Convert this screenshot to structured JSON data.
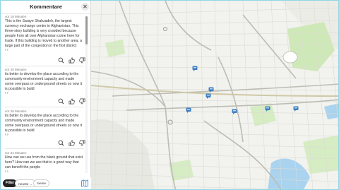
{
  "panel": {
    "title": "Kommentare",
    "close_symbol": "✕"
  },
  "comments": [
    {
      "time": "vor 18 Minuten",
      "text": "This is the Saraye Shahzadeh, the largest currency exchange centre in Afghanistan. This three-story building is very crowded because people from all over Afghanistan come here for trade. If this building is moved to another area, a large part of the congestion in the first district",
      "more": "‹  ›"
    },
    {
      "time": "vor 20 Minuten",
      "text": "its better to develop the place according to the community environment capacity and made some overpass or underground streets so now it is possible to build",
      "more": "‹  ›"
    },
    {
      "time": "vor 26 Minuten",
      "text": "its better to develop the place according to the community environment capacity and made some overpass or underground streets so now it is possible to build",
      "more": "‹  ›"
    },
    {
      "time": "vor 34 Minuten",
      "text": "How can we use from the blank ground that exist here? How can we use that in a good way that can benefit the people",
      "more": "‹  ›"
    }
  ],
  "toolbar": {
    "filter_label": "Filter",
    "sort_newest": "neuste",
    "sort_mine": "meine",
    "chevron": "⌄"
  },
  "icons": {
    "search": "search-icon",
    "like": "thumbs-up-icon",
    "dislike": "thumbs-down-icon",
    "map": "map-icon",
    "marker": "comment-marker-icon"
  },
  "colors": {
    "accent": "#4a8fd4",
    "marker": "#3d7fc2",
    "park": "#cfe8b8",
    "water": "#a9d3ef"
  }
}
